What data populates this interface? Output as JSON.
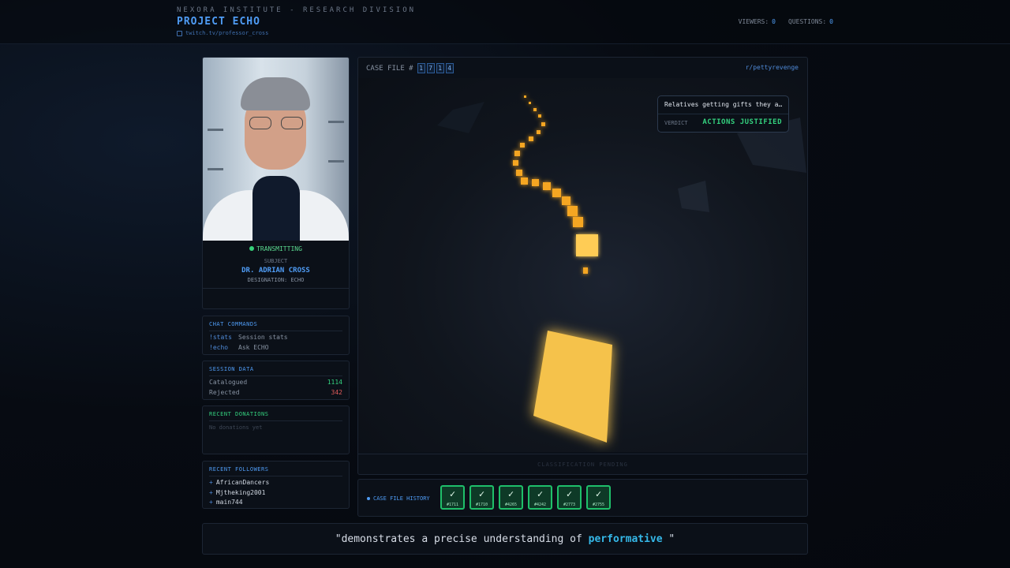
{
  "header": {
    "org": "NEXORA INSTITUTE - RESEARCH DIVISION",
    "project": "PROJECT ECHO",
    "channel": "twitch.tv/professor_cross",
    "viewers_label": "VIEWERS:",
    "viewers": "0",
    "questions_label": "QUESTIONS:",
    "questions": "0"
  },
  "subject": {
    "status": "TRANSMITTING",
    "label": "SUBJECT",
    "name": "DR. ADRIAN CROSS",
    "designation": "DESIGNATION: ECHO"
  },
  "chat_commands": {
    "title": "CHAT COMMANDS",
    "items": [
      {
        "cmd": "!stats",
        "desc": "Session stats"
      },
      {
        "cmd": "!echo",
        "desc": "Ask ECHO"
      }
    ]
  },
  "session_data": {
    "title": "SESSION DATA",
    "catalogued_label": "Catalogued",
    "catalogued": "1114",
    "rejected_label": "Rejected",
    "rejected": "342"
  },
  "donations": {
    "title": "RECENT DONATIONS",
    "empty": "No donations yet"
  },
  "followers": {
    "title": "RECENT FOLLOWERS",
    "items": [
      "AfricanDancers",
      "Mjtheking2001",
      "main744"
    ]
  },
  "case": {
    "label": "CASE FILE #",
    "digits": [
      "1",
      "7",
      "1",
      "4"
    ],
    "subreddit": "r/pettyrevenge",
    "question": "Relatives getting gifts they asked for...",
    "verdict_label": "VERDICT",
    "verdict": "ACTIONS JUSTIFIED",
    "footer": "CLASSIFICATION PENDING"
  },
  "history": {
    "title": "CASE FILE HISTORY",
    "items": [
      {
        "check": "✓",
        "id": "#1711"
      },
      {
        "check": "✓",
        "id": "#1710"
      },
      {
        "check": "✓",
        "id": "#4265"
      },
      {
        "check": "✓",
        "id": "#4242"
      },
      {
        "check": "✓",
        "id": "#2773"
      },
      {
        "check": "✓",
        "id": "#2755"
      }
    ]
  },
  "quote": {
    "prefix": "\"demonstrates a precise understanding of ",
    "highlight": "performative",
    "suffix": " \""
  },
  "colors": {
    "accent": "#4f9cf5",
    "success": "#34d27f",
    "danger": "#e05a5a",
    "highlight": "#35b8e8"
  }
}
